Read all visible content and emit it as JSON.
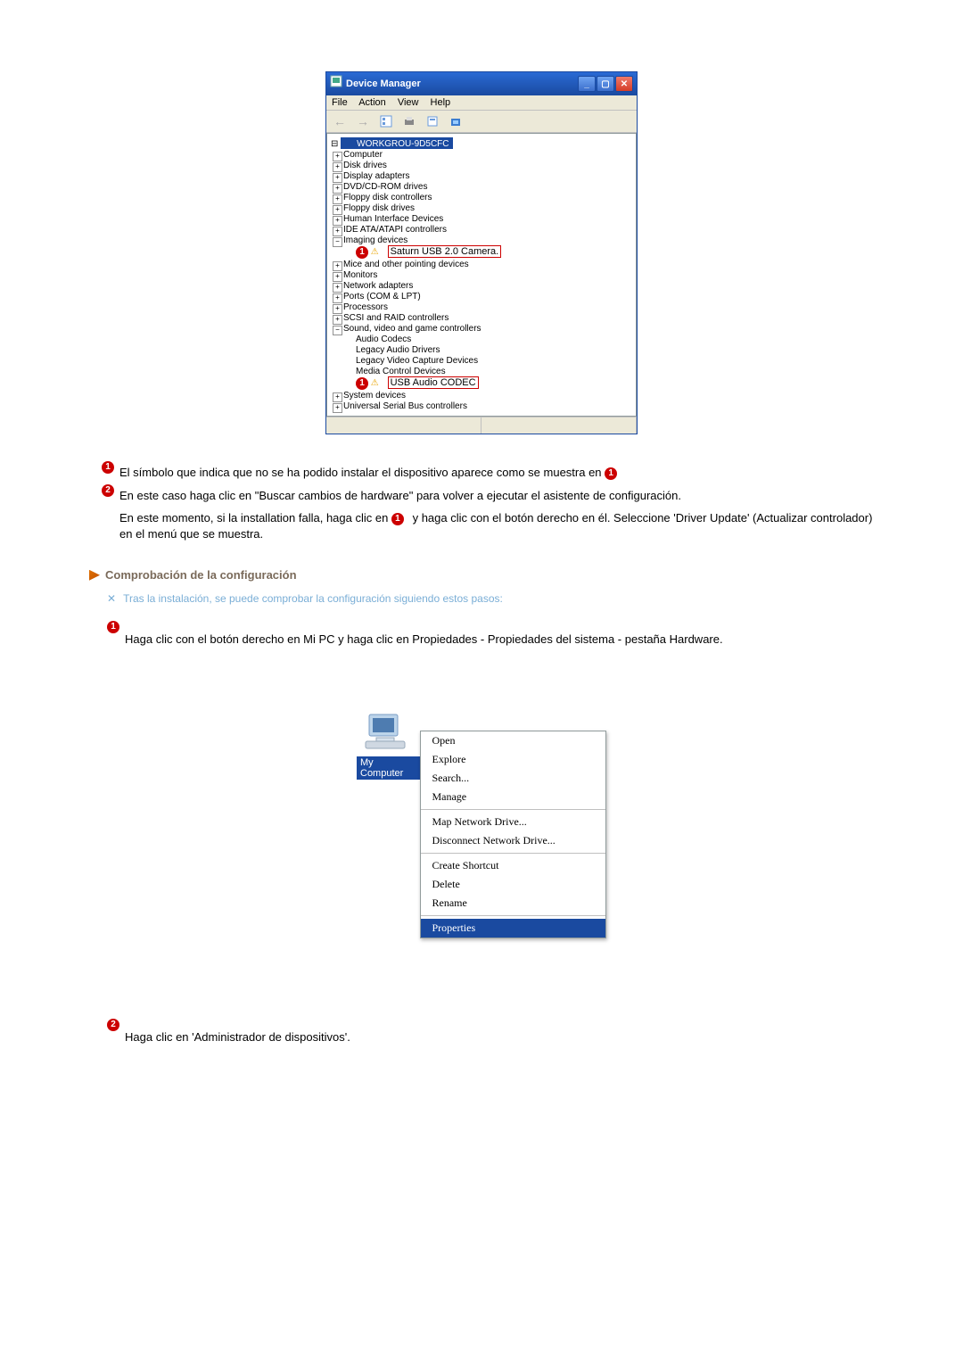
{
  "dm": {
    "title": "Device Manager",
    "menu": {
      "file": "File",
      "action": "Action",
      "view": "View",
      "help": "Help"
    },
    "root": "WORKGROU-9D5CFC",
    "plus": "+",
    "minus": "−",
    "items": {
      "computer": "Computer",
      "disk": "Disk drives",
      "display": "Display adapters",
      "dvd": "DVD/CD-ROM drives",
      "floppyctl": "Floppy disk controllers",
      "floppy": "Floppy disk drives",
      "hid": "Human Interface Devices",
      "ide": "IDE ATA/ATAPI controllers",
      "imaging": "Imaging devices",
      "saturn": "Saturn USB 2.0 Camera.",
      "mice": "Mice and other pointing devices",
      "monitors": "Monitors",
      "net": "Network adapters",
      "ports": "Ports (COM & LPT)",
      "proc": "Processors",
      "scsi": "SCSI and RAID controllers",
      "sound": "Sound, video and game controllers",
      "audio": "Audio Codecs",
      "legacy": "Legacy Audio Drivers",
      "capture": "Legacy Video Capture Devices",
      "media": "Media Control Devices",
      "usbaudio": "USB Audio CODEC",
      "sys": "System devices",
      "usbctl": "Universal Serial Bus controllers"
    }
  },
  "inst": {
    "n1": "1",
    "n2": "2",
    "t1a": "El símbolo que indica que no se ha podido instalar el dispositivo aparece como se muestra en ",
    "t2a": "En este caso haga clic en \"Buscar cambios de hardware\" para volver a ejecutar el asistente de configuración.",
    "t2b_a": "En este momento, si la installation falla, haga clic en ",
    "t2b_b": " y haga clic con el botón derecho en él. Seleccione 'Driver Update' (Actualizar controlador) en el menú que se muestra."
  },
  "sect": {
    "title": "Comprobación de la configuración",
    "note": "Tras la instalación, se puede comprobar la configuración siguiendo estos pasos:",
    "x": "✕",
    "step1": "Haga clic con el botón derecho en Mi PC y haga clic en Propiedades - Propiedades del sistema - pestaña Hardware.",
    "step2": "Haga clic en 'Administrador de dispositivos'."
  },
  "ctx": {
    "label": "My Computer",
    "open": "Open",
    "explore": "Explore",
    "search": "Search...",
    "manage": "Manage",
    "map": "Map Network Drive...",
    "disc": "Disconnect Network Drive...",
    "shortcut": "Create Shortcut",
    "delete": "Delete",
    "rename": "Rename",
    "props": "Properties"
  }
}
